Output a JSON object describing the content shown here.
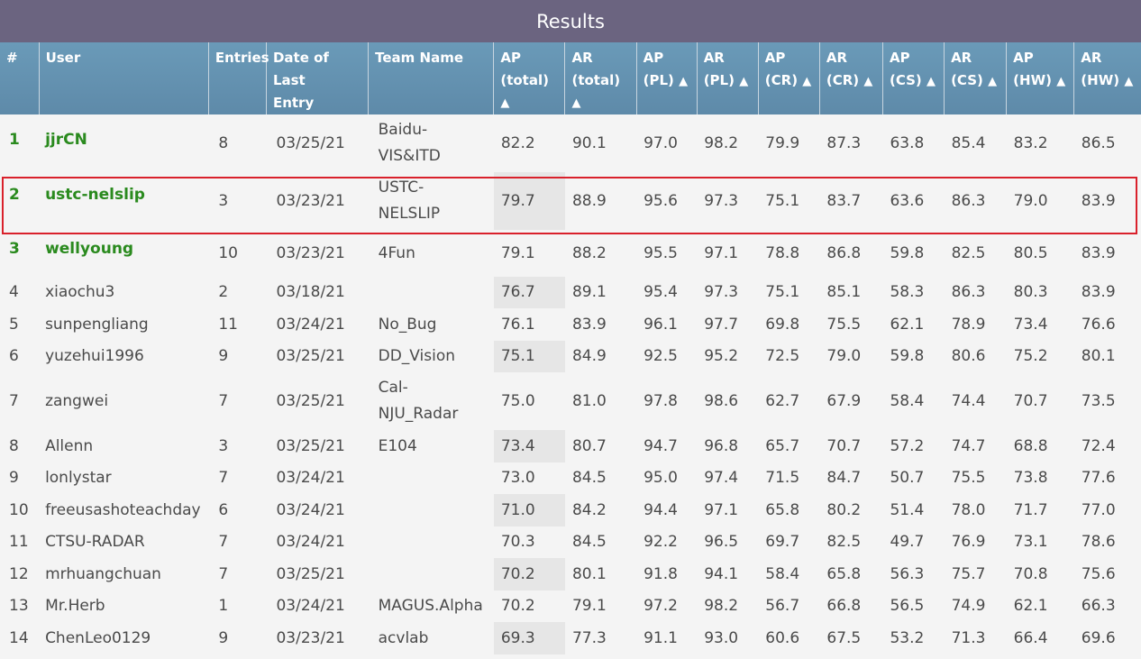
{
  "title": "Results",
  "headers": [
    {
      "key": "rank",
      "line1": "#",
      "line2": "",
      "sort": ""
    },
    {
      "key": "user",
      "line1": "User",
      "line2": "",
      "sort": ""
    },
    {
      "key": "entries",
      "line1": "Entries",
      "line2": "",
      "sort": ""
    },
    {
      "key": "date",
      "line1": "Date of Last",
      "line2": "Entry",
      "sort": ""
    },
    {
      "key": "team",
      "line1": "Team Name",
      "line2": "",
      "sort": ""
    },
    {
      "key": "ap_total",
      "line1": "AP",
      "line2": "(total)",
      "sort": "▲"
    },
    {
      "key": "ar_total",
      "line1": "AR",
      "line2": "(total)",
      "sort": "▲"
    },
    {
      "key": "ap_pl",
      "line1": "AP",
      "line2": "(PL)",
      "sort": "▲"
    },
    {
      "key": "ar_pl",
      "line1": "AR",
      "line2": "(PL)",
      "sort": "▲"
    },
    {
      "key": "ap_cr",
      "line1": "AP",
      "line2": "(CR)",
      "sort": "▲"
    },
    {
      "key": "ar_cr",
      "line1": "AR",
      "line2": "(CR)",
      "sort": "▲"
    },
    {
      "key": "ap_cs",
      "line1": "AP",
      "line2": "(CS)",
      "sort": "▲"
    },
    {
      "key": "ar_cs",
      "line1": "AR",
      "line2": "(CS)",
      "sort": "▲"
    },
    {
      "key": "ap_hw",
      "line1": "AP",
      "line2": "(HW)",
      "sort": "▲"
    },
    {
      "key": "ar_hw",
      "line1": "AR",
      "line2": "(HW)",
      "sort": "▲"
    }
  ],
  "rows": [
    {
      "rank": "1",
      "user": "jjrCN",
      "entries": "8",
      "date": "03/25/21",
      "team": "Baidu-VIS&ITD",
      "team_lines": [
        "Baidu-",
        "VIS&ITD"
      ],
      "vals": [
        "82.2",
        "90.1",
        "97.0",
        "98.2",
        "79.9",
        "87.3",
        "63.8",
        "85.4",
        "83.2",
        "86.5"
      ],
      "top3": true,
      "shade": false
    },
    {
      "rank": "2",
      "user": "ustc-nelslip",
      "entries": "3",
      "date": "03/23/21",
      "team": "USTC-NELSLIP",
      "team_lines": [
        "USTC-",
        "NELSLIP"
      ],
      "vals": [
        "79.7",
        "88.9",
        "95.6",
        "97.3",
        "75.1",
        "83.7",
        "63.6",
        "86.3",
        "79.0",
        "83.9"
      ],
      "top3": true,
      "shade": true,
      "highlighted": true
    },
    {
      "rank": "3",
      "user": "wellyoung",
      "entries": "10",
      "date": "03/23/21",
      "team": "4Fun",
      "team_lines": [
        "4Fun"
      ],
      "vals": [
        "79.1",
        "88.2",
        "95.5",
        "97.1",
        "78.8",
        "86.8",
        "59.8",
        "82.5",
        "80.5",
        "83.9"
      ],
      "top3": true,
      "shade": false
    },
    {
      "rank": "4",
      "user": "xiaochu3",
      "entries": "2",
      "date": "03/18/21",
      "team": "",
      "team_lines": [
        ""
      ],
      "vals": [
        "76.7",
        "89.1",
        "95.4",
        "97.3",
        "75.1",
        "85.1",
        "58.3",
        "86.3",
        "80.3",
        "83.9"
      ],
      "top3": false,
      "shade": true
    },
    {
      "rank": "5",
      "user": "sunpengliang",
      "entries": "11",
      "date": "03/24/21",
      "team": "No_Bug",
      "team_lines": [
        "No_Bug"
      ],
      "vals": [
        "76.1",
        "83.9",
        "96.1",
        "97.7",
        "69.8",
        "75.5",
        "62.1",
        "78.9",
        "73.4",
        "76.6"
      ],
      "top3": false,
      "shade": false
    },
    {
      "rank": "6",
      "user": "yuzehui1996",
      "entries": "9",
      "date": "03/25/21",
      "team": "DD_Vision",
      "team_lines": [
        "DD_Vision"
      ],
      "vals": [
        "75.1",
        "84.9",
        "92.5",
        "95.2",
        "72.5",
        "79.0",
        "59.8",
        "80.6",
        "75.2",
        "80.1"
      ],
      "top3": false,
      "shade": true
    },
    {
      "rank": "7",
      "user": "zangwei",
      "entries": "7",
      "date": "03/25/21",
      "team": "Cal-NJU_Radar",
      "team_lines": [
        "Cal-",
        "NJU_Radar"
      ],
      "vals": [
        "75.0",
        "81.0",
        "97.8",
        "98.6",
        "62.7",
        "67.9",
        "58.4",
        "74.4",
        "70.7",
        "73.5"
      ],
      "top3": false,
      "shade": false
    },
    {
      "rank": "8",
      "user": "Allenn",
      "entries": "3",
      "date": "03/25/21",
      "team": "E104",
      "team_lines": [
        "E104"
      ],
      "vals": [
        "73.4",
        "80.7",
        "94.7",
        "96.8",
        "65.7",
        "70.7",
        "57.2",
        "74.7",
        "68.8",
        "72.4"
      ],
      "top3": false,
      "shade": true
    },
    {
      "rank": "9",
      "user": "lonlystar",
      "entries": "7",
      "date": "03/24/21",
      "team": "",
      "team_lines": [
        ""
      ],
      "vals": [
        "73.0",
        "84.5",
        "95.0",
        "97.4",
        "71.5",
        "84.7",
        "50.7",
        "75.5",
        "73.8",
        "77.6"
      ],
      "top3": false,
      "shade": false
    },
    {
      "rank": "10",
      "user": "freeusashoteachday",
      "entries": "6",
      "date": "03/24/21",
      "team": "",
      "team_lines": [
        ""
      ],
      "vals": [
        "71.0",
        "84.2",
        "94.4",
        "97.1",
        "65.8",
        "80.2",
        "51.4",
        "78.0",
        "71.7",
        "77.0"
      ],
      "top3": false,
      "shade": true
    },
    {
      "rank": "11",
      "user": "CTSU-RADAR",
      "entries": "7",
      "date": "03/24/21",
      "team": "",
      "team_lines": [
        ""
      ],
      "vals": [
        "70.3",
        "84.5",
        "92.2",
        "96.5",
        "69.7",
        "82.5",
        "49.7",
        "76.9",
        "73.1",
        "78.6"
      ],
      "top3": false,
      "shade": false
    },
    {
      "rank": "12",
      "user": "mrhuangchuan",
      "entries": "7",
      "date": "03/25/21",
      "team": "",
      "team_lines": [
        ""
      ],
      "vals": [
        "70.2",
        "80.1",
        "91.8",
        "94.1",
        "58.4",
        "65.8",
        "56.3",
        "75.7",
        "70.8",
        "75.6"
      ],
      "top3": false,
      "shade": true
    },
    {
      "rank": "13",
      "user": "Mr.Herb",
      "entries": "1",
      "date": "03/24/21",
      "team": "MAGUS.Alpha",
      "team_lines": [
        "MAGUS.Alpha"
      ],
      "vals": [
        "70.2",
        "79.1",
        "97.2",
        "98.2",
        "56.7",
        "66.8",
        "56.5",
        "74.9",
        "62.1",
        "66.3"
      ],
      "top3": false,
      "shade": false
    },
    {
      "rank": "14",
      "user": "ChenLeo0129",
      "entries": "9",
      "date": "03/23/21",
      "team": "acvlab",
      "team_lines": [
        "acvlab"
      ],
      "vals": [
        "69.3",
        "77.3",
        "91.1",
        "93.0",
        "60.6",
        "67.5",
        "53.2",
        "71.3",
        "66.4",
        "69.6"
      ],
      "top3": false,
      "shade": true
    }
  ]
}
